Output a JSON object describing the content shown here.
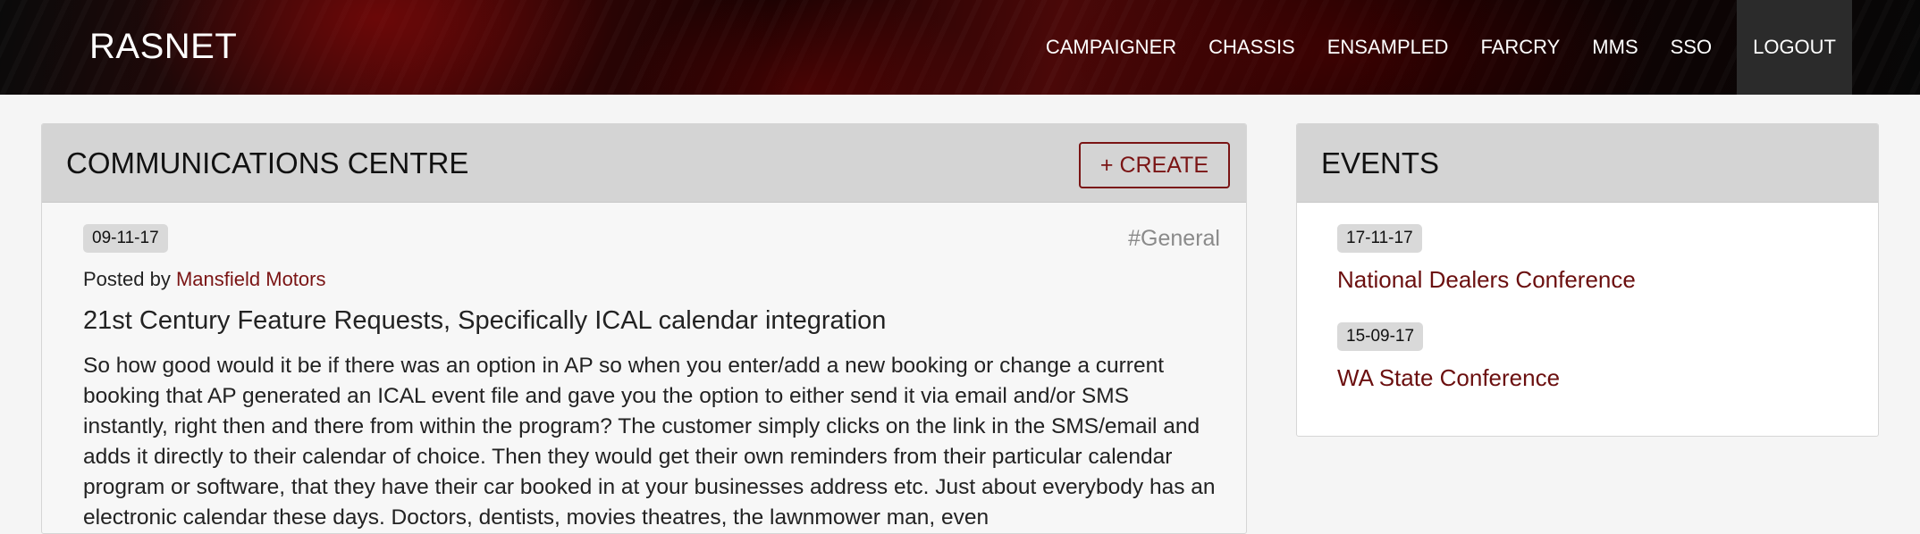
{
  "navbar": {
    "brand": "RASNET",
    "items": [
      {
        "label": "CAMPAIGNER"
      },
      {
        "label": "CHASSIS"
      },
      {
        "label": "ENSAMPLED"
      },
      {
        "label": "FARCRY"
      },
      {
        "label": "MMS"
      },
      {
        "label": "SSO"
      }
    ],
    "logout": "LOGOUT"
  },
  "communications": {
    "title": "COMMUNICATIONS CENTRE",
    "create_label": "+ CREATE",
    "post": {
      "date": "09-11-17",
      "tag": "#General",
      "posted_by_prefix": "Posted by",
      "author": "Mansfield Motors",
      "title": "21st Century Feature Requests, Specifically ICAL calendar integration",
      "body": "So how good would it be if there was an option in AP so when you enter/add a new booking or change a current booking that AP generated an ICAL event file and gave you the option to either send it via email and/or SMS instantly, right then and there from within the program? The customer simply clicks on the link in the SMS/email and adds it directly to their calendar of choice. Then they would get their own reminders from their particular calendar program or software, that they have their car booked in at your businesses address etc. Just about everybody has an electronic calendar these days. Doctors, dentists, movies theatres, the lawnmower man, even"
    }
  },
  "events": {
    "title": "EVENTS",
    "items": [
      {
        "date": "17-11-17",
        "name": "National Dealers Conference"
      },
      {
        "date": "15-09-17",
        "name": "WA State Conference"
      }
    ]
  },
  "colors": {
    "accent": "#7a1414",
    "panel_heading": "#d4d4d4",
    "page_bg": "#f5f5f5"
  }
}
